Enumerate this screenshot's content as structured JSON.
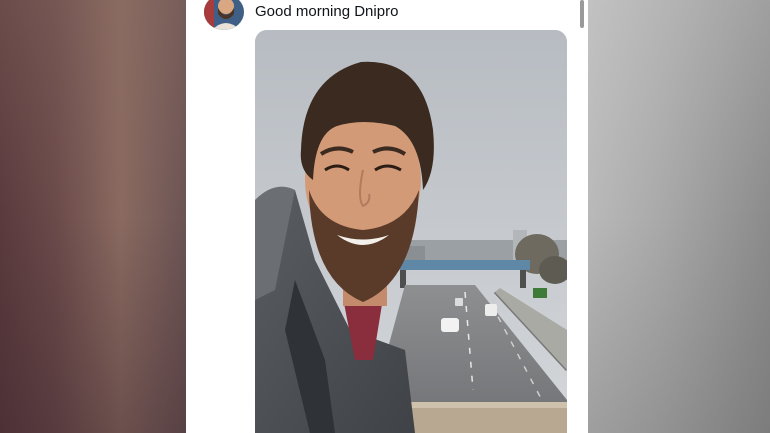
{
  "tweet": {
    "text": "Good morning Dnipro",
    "avatar_icon": "user-avatar",
    "photo_icon": "selfie-photo"
  },
  "colors": {
    "card_bg": "#ffffff",
    "text": "#0f1419",
    "left_backdrop": "#6b4a4a",
    "right_backdrop": "#a9a9a9"
  }
}
